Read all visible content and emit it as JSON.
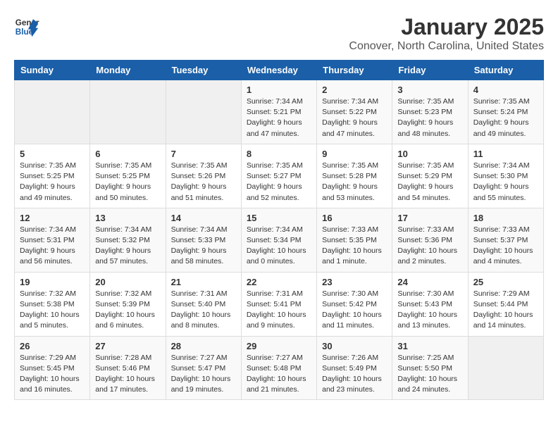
{
  "logo": {
    "text_general": "General",
    "text_blue": "Blue"
  },
  "title": "January 2025",
  "subtitle": "Conover, North Carolina, United States",
  "days_of_week": [
    "Sunday",
    "Monday",
    "Tuesday",
    "Wednesday",
    "Thursday",
    "Friday",
    "Saturday"
  ],
  "weeks": [
    [
      {
        "num": "",
        "info": ""
      },
      {
        "num": "",
        "info": ""
      },
      {
        "num": "",
        "info": ""
      },
      {
        "num": "1",
        "info": "Sunrise: 7:34 AM\nSunset: 5:21 PM\nDaylight: 9 hours and 47 minutes."
      },
      {
        "num": "2",
        "info": "Sunrise: 7:34 AM\nSunset: 5:22 PM\nDaylight: 9 hours and 47 minutes."
      },
      {
        "num": "3",
        "info": "Sunrise: 7:35 AM\nSunset: 5:23 PM\nDaylight: 9 hours and 48 minutes."
      },
      {
        "num": "4",
        "info": "Sunrise: 7:35 AM\nSunset: 5:24 PM\nDaylight: 9 hours and 49 minutes."
      }
    ],
    [
      {
        "num": "5",
        "info": "Sunrise: 7:35 AM\nSunset: 5:25 PM\nDaylight: 9 hours and 49 minutes."
      },
      {
        "num": "6",
        "info": "Sunrise: 7:35 AM\nSunset: 5:25 PM\nDaylight: 9 hours and 50 minutes."
      },
      {
        "num": "7",
        "info": "Sunrise: 7:35 AM\nSunset: 5:26 PM\nDaylight: 9 hours and 51 minutes."
      },
      {
        "num": "8",
        "info": "Sunrise: 7:35 AM\nSunset: 5:27 PM\nDaylight: 9 hours and 52 minutes."
      },
      {
        "num": "9",
        "info": "Sunrise: 7:35 AM\nSunset: 5:28 PM\nDaylight: 9 hours and 53 minutes."
      },
      {
        "num": "10",
        "info": "Sunrise: 7:35 AM\nSunset: 5:29 PM\nDaylight: 9 hours and 54 minutes."
      },
      {
        "num": "11",
        "info": "Sunrise: 7:34 AM\nSunset: 5:30 PM\nDaylight: 9 hours and 55 minutes."
      }
    ],
    [
      {
        "num": "12",
        "info": "Sunrise: 7:34 AM\nSunset: 5:31 PM\nDaylight: 9 hours and 56 minutes."
      },
      {
        "num": "13",
        "info": "Sunrise: 7:34 AM\nSunset: 5:32 PM\nDaylight: 9 hours and 57 minutes."
      },
      {
        "num": "14",
        "info": "Sunrise: 7:34 AM\nSunset: 5:33 PM\nDaylight: 9 hours and 58 minutes."
      },
      {
        "num": "15",
        "info": "Sunrise: 7:34 AM\nSunset: 5:34 PM\nDaylight: 10 hours and 0 minutes."
      },
      {
        "num": "16",
        "info": "Sunrise: 7:33 AM\nSunset: 5:35 PM\nDaylight: 10 hours and 1 minute."
      },
      {
        "num": "17",
        "info": "Sunrise: 7:33 AM\nSunset: 5:36 PM\nDaylight: 10 hours and 2 minutes."
      },
      {
        "num": "18",
        "info": "Sunrise: 7:33 AM\nSunset: 5:37 PM\nDaylight: 10 hours and 4 minutes."
      }
    ],
    [
      {
        "num": "19",
        "info": "Sunrise: 7:32 AM\nSunset: 5:38 PM\nDaylight: 10 hours and 5 minutes."
      },
      {
        "num": "20",
        "info": "Sunrise: 7:32 AM\nSunset: 5:39 PM\nDaylight: 10 hours and 6 minutes."
      },
      {
        "num": "21",
        "info": "Sunrise: 7:31 AM\nSunset: 5:40 PM\nDaylight: 10 hours and 8 minutes."
      },
      {
        "num": "22",
        "info": "Sunrise: 7:31 AM\nSunset: 5:41 PM\nDaylight: 10 hours and 9 minutes."
      },
      {
        "num": "23",
        "info": "Sunrise: 7:30 AM\nSunset: 5:42 PM\nDaylight: 10 hours and 11 minutes."
      },
      {
        "num": "24",
        "info": "Sunrise: 7:30 AM\nSunset: 5:43 PM\nDaylight: 10 hours and 13 minutes."
      },
      {
        "num": "25",
        "info": "Sunrise: 7:29 AM\nSunset: 5:44 PM\nDaylight: 10 hours and 14 minutes."
      }
    ],
    [
      {
        "num": "26",
        "info": "Sunrise: 7:29 AM\nSunset: 5:45 PM\nDaylight: 10 hours and 16 minutes."
      },
      {
        "num": "27",
        "info": "Sunrise: 7:28 AM\nSunset: 5:46 PM\nDaylight: 10 hours and 17 minutes."
      },
      {
        "num": "28",
        "info": "Sunrise: 7:27 AM\nSunset: 5:47 PM\nDaylight: 10 hours and 19 minutes."
      },
      {
        "num": "29",
        "info": "Sunrise: 7:27 AM\nSunset: 5:48 PM\nDaylight: 10 hours and 21 minutes."
      },
      {
        "num": "30",
        "info": "Sunrise: 7:26 AM\nSunset: 5:49 PM\nDaylight: 10 hours and 23 minutes."
      },
      {
        "num": "31",
        "info": "Sunrise: 7:25 AM\nSunset: 5:50 PM\nDaylight: 10 hours and 24 minutes."
      },
      {
        "num": "",
        "info": ""
      }
    ]
  ]
}
